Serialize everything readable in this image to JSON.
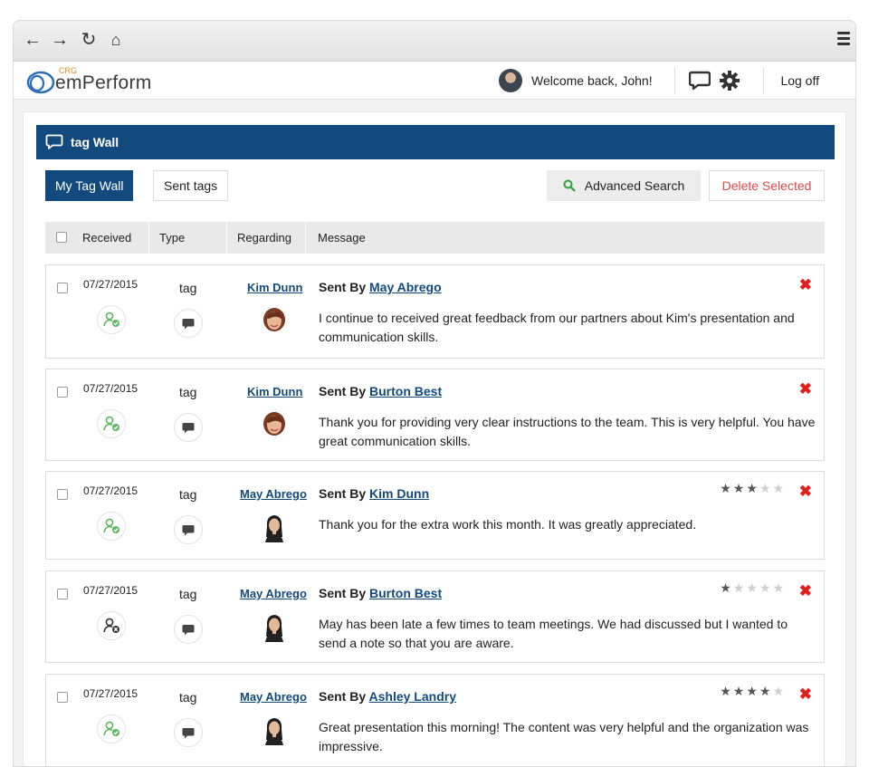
{
  "app": {
    "brand": "emPerform",
    "brand_prefix": "CRG",
    "welcome": "Welcome back, John!",
    "logoff": "Log off"
  },
  "page": {
    "title": "tag Wall",
    "tabs": [
      "My Tag Wall",
      "Sent tags"
    ],
    "advanced_search": "Advanced Search",
    "delete_selected": "Delete Selected"
  },
  "table": {
    "columns": [
      "Received",
      "Type",
      "Regarding",
      "Message"
    ],
    "sent_by_prefix": "Sent By",
    "rows": [
      {
        "date": "07/27/2015",
        "type": "tag",
        "regarding": "Kim Dunn",
        "sender": "May Abrego",
        "message": "I continue to received great feedback from our partners about Kim's presentation and communication skills.",
        "stars": null,
        "status": "approved"
      },
      {
        "date": "07/27/2015",
        "type": "tag",
        "regarding": "Kim Dunn",
        "sender": "Burton Best",
        "message": "Thank you for providing very clear instructions to the team. This is very helpful. You have great communication skills.",
        "stars": null,
        "status": "approved"
      },
      {
        "date": "07/27/2015",
        "type": "tag",
        "regarding": "May Abrego",
        "sender": "Kim Dunn",
        "message": "Thank you for the extra work this month. It was greatly appreciated.",
        "stars": 3,
        "status": "approved"
      },
      {
        "date": "07/27/2015",
        "type": "tag",
        "regarding": "May Abrego",
        "sender": "Burton Best",
        "message": "May has been late a few times to team meetings. We had discussed but I wanted to send a note so that you are aware.",
        "stars": 1,
        "status": "declined"
      },
      {
        "date": "07/27/2015",
        "type": "tag",
        "regarding": "May Abrego",
        "sender": "Ashley Landry",
        "message": "Great presentation this morning! The content was very helpful and the organization was impressive.",
        "stars": 4,
        "status": "approved"
      }
    ]
  },
  "colors": {
    "primary": "#124a7e",
    "danger": "#e21d1d",
    "approved": "#5cb85c"
  }
}
